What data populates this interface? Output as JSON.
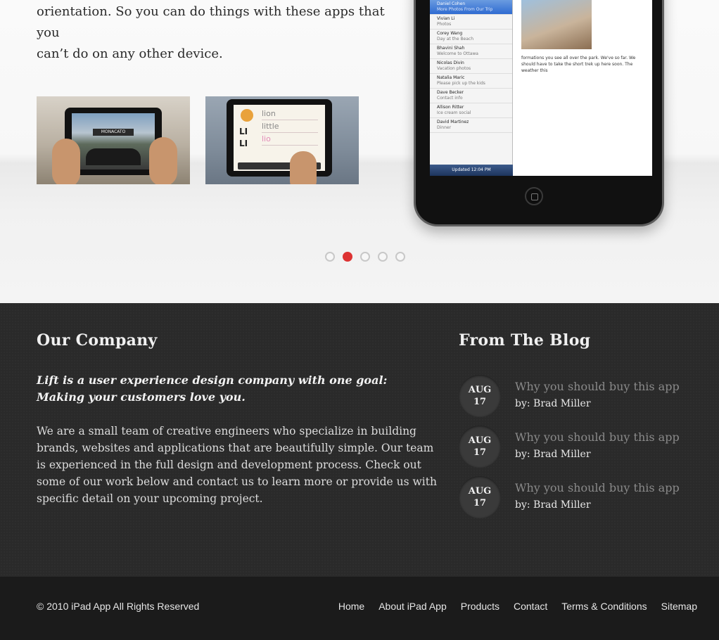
{
  "hero": {
    "text_line1": "orientation. So you can do things with these apps that you",
    "text_line2": "can’t do on any other device.",
    "thumb_1_sign": "MONACATO",
    "thumb_2_words": [
      "lion",
      "little",
      "lio"
    ],
    "thumb_2_letters": [
      "LI",
      "LI"
    ],
    "slider_dots": 5,
    "active_dot": 2
  },
  "ipad_mail": {
    "items": [
      {
        "name": "Daniel Cohen",
        "sub": "More Photos From Our Trip",
        "selected": true
      },
      {
        "name": "Vivian Li",
        "sub": "Photos",
        "selected": false
      },
      {
        "name": "Corey Wang",
        "sub": "Day at the Beach",
        "selected": false
      },
      {
        "name": "Bhavini Shah",
        "sub": "Welcome to Ottawa",
        "selected": false
      },
      {
        "name": "Nicolas Divin",
        "sub": "Vacation photos",
        "selected": false
      },
      {
        "name": "Natalia Maric",
        "sub": "Please pick up the kids",
        "selected": false
      },
      {
        "name": "Dave Becker",
        "sub": "Contact info",
        "selected": false
      },
      {
        "name": "Allison Ritter",
        "sub": "Ice cream social",
        "selected": false
      },
      {
        "name": "David Martinez",
        "sub": "Dinner",
        "selected": false
      }
    ],
    "status": "Updated 12:04 PM",
    "body": "formations you see all over the park. We've so far. We should have to take the short trek up here soon. The weather this"
  },
  "company": {
    "heading": "Our Company",
    "tagline": "Lift is a user experience design company with one goal: Making your customers love you.",
    "about": "We are a small team of creative engineers who specialize in building brands, websites and applications that are beautifully simple. Our team is experienced in the full design and development process. Check out some of our work below and contact us to learn more or provide us with specific detail on your upcoming project."
  },
  "blog": {
    "heading": "From The Blog",
    "posts": [
      {
        "month": "AUG",
        "day": "17",
        "title": "Why you should buy this app",
        "author": "by: Brad Miller"
      },
      {
        "month": "AUG",
        "day": "17",
        "title": "Why you should buy this app",
        "author": "by: Brad Miller"
      },
      {
        "month": "AUG",
        "day": "17",
        "title": "Why you should buy this app",
        "author": "by: Brad Miller"
      }
    ]
  },
  "footer": {
    "copyright": "© 2010 iPad App All Rights Reserved",
    "nav": [
      "Home",
      "About iPad App",
      "Products",
      "Contact",
      "Terms & Conditions",
      "Sitemap"
    ]
  },
  "colors": {
    "accent": "#dd3333",
    "dark_bg": "#2a2a2a",
    "footer_bg": "#1b1b1b"
  }
}
